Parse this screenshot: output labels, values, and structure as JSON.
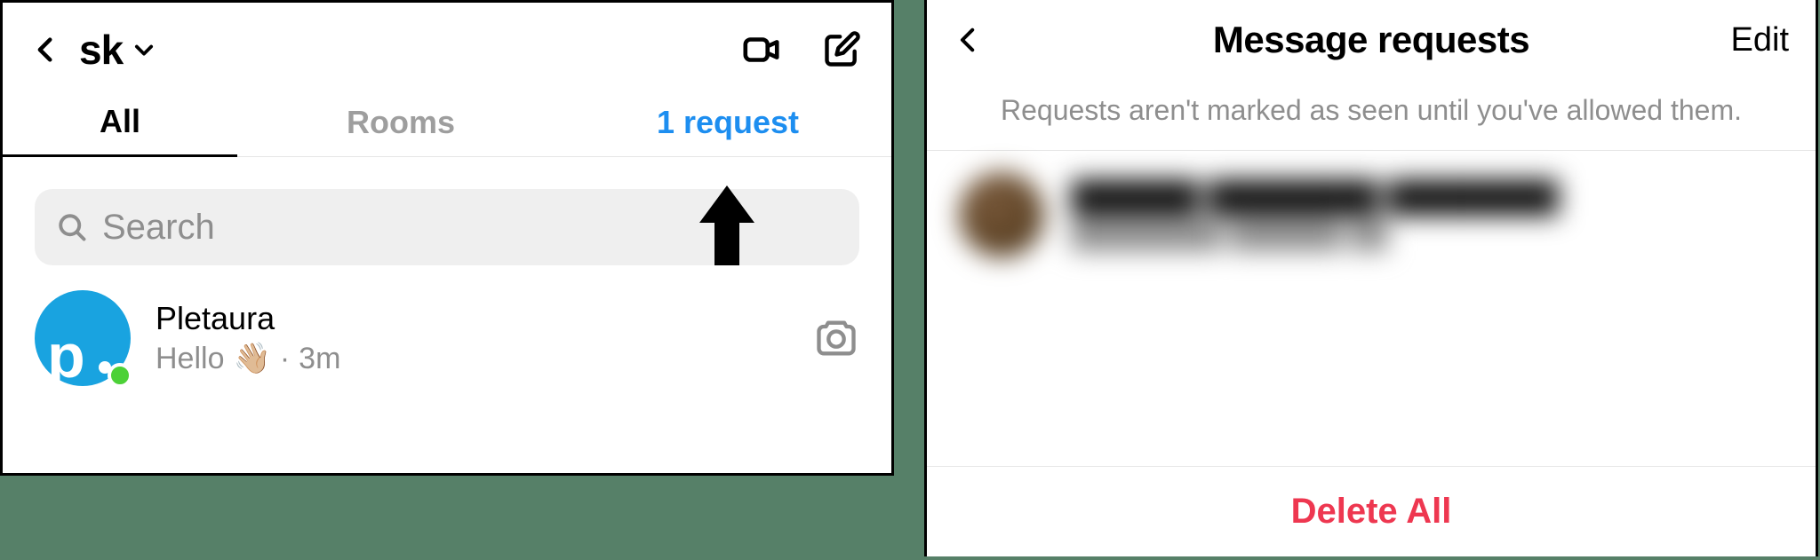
{
  "left": {
    "account_label": "sk",
    "tabs": {
      "all": "All",
      "rooms": "Rooms",
      "request": "1 request"
    },
    "search_placeholder": "Search",
    "conversation": {
      "name": "Pletaura",
      "preview": "Hello",
      "wave": "👋🏼",
      "separator": "·",
      "time": "3m",
      "avatar_letter": "p"
    }
  },
  "right": {
    "title": "Message requests",
    "edit": "Edit",
    "note": "Requests aren't marked as seen until you've allowed them.",
    "delete_all": "Delete All",
    "request_row": {
      "line1": "██████ ████████ ████████",
      "line2": "████████ ██████ ██"
    }
  }
}
